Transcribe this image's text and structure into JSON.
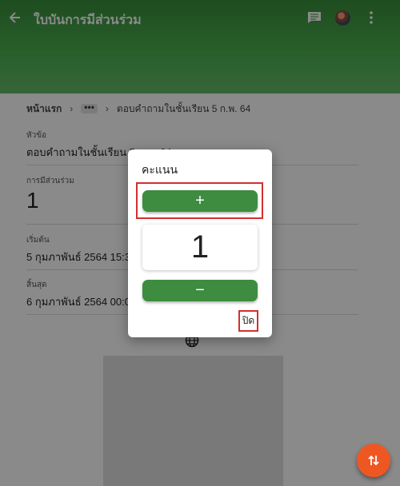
{
  "appbar": {
    "title": "ใบบันการมีส่วนร่วม",
    "icons": [
      "back-arrow-icon",
      "chat-icon",
      "avatar",
      "more-vert-icon"
    ]
  },
  "breadcrumb": {
    "home": "หน้าแรก",
    "ellipsis": "•••",
    "current": "ตอบคำถามในชั้นเรียน 5 ก.พ. 64"
  },
  "fields": {
    "topic": {
      "label": "หัวข้อ",
      "value": "ตอบคำถามในชั้นเรียน 5 ก.พ. 64"
    },
    "participation": {
      "label": "การมีส่วนร่วม",
      "value": "1"
    },
    "start": {
      "label": "เริ่มต้น",
      "value": "5 กุมภาพันธ์ 2564 15:30"
    },
    "end": {
      "label": "สิ้นสุด",
      "value": "6 กุมภาพันธ์ 2564 00:00"
    }
  },
  "dialog": {
    "title": "คะแนน",
    "plus_label": "+",
    "score": "1",
    "minus_label": "−",
    "close_label": "ปิด"
  },
  "colors": {
    "appbar": "#4caf50",
    "button": "#3d8c40",
    "fab": "#ef5722",
    "highlight": "#d32f2f"
  }
}
